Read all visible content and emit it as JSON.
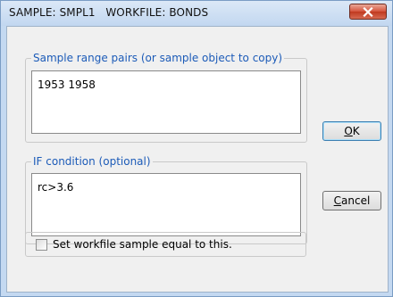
{
  "window": {
    "title": "SAMPLE: SMPL1   WORKFILE: BONDS",
    "close_icon": "close-x-icon",
    "colors": {
      "frame": "#c4d9f1",
      "legend": "#1c5bb8",
      "close_button": "#c0391f"
    }
  },
  "sample_range": {
    "legend": "Sample range pairs (or sample object to copy)",
    "value": "1953 1958"
  },
  "if_condition": {
    "legend": "IF condition (optional)",
    "value": "rc>3.6"
  },
  "buttons": {
    "ok_mnemonic": "O",
    "ok_rest": "K",
    "cancel_mnemonic": "C",
    "cancel_rest": "ancel"
  },
  "checkbox": {
    "label": "Set workfile sample equal to this.",
    "checked": false
  }
}
